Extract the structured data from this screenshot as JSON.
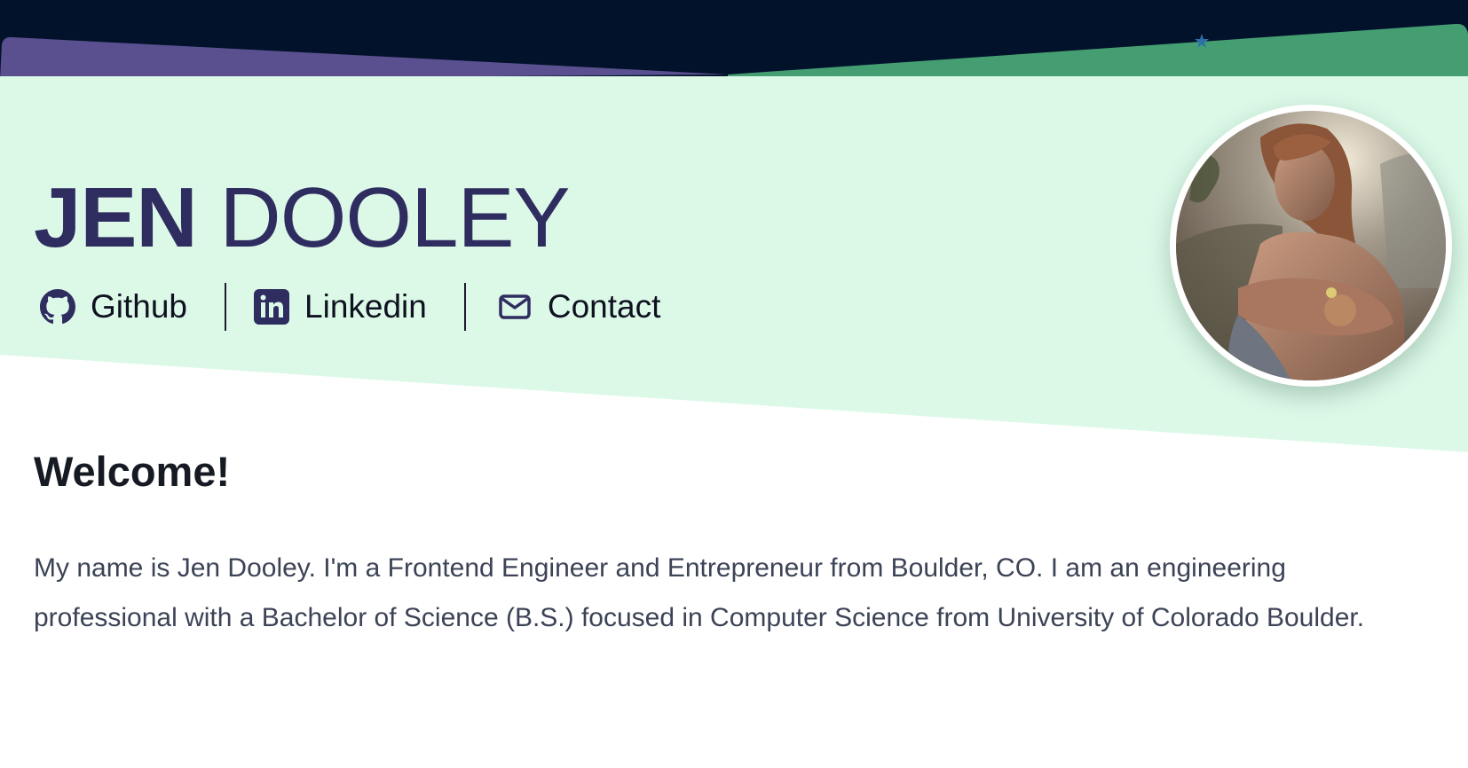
{
  "header": {
    "first_name": "JEN",
    "last_name": "DOOLEY",
    "links": [
      {
        "label": "Github",
        "icon": "github-icon"
      },
      {
        "label": "Linkedin",
        "icon": "linkedin-icon"
      },
      {
        "label": "Contact",
        "icon": "mail-icon"
      }
    ],
    "avatar": "profile-photo"
  },
  "main": {
    "heading": "Welcome!",
    "intro": "My name is Jen Dooley. I'm a Frontend Engineer and Entrepreneur from Boulder, CO. I am an engineering professional with a Bachelor of Science (B.S.) focused in Computer Science from University of Colorado Boulder."
  },
  "colors": {
    "top_band": "#02122a",
    "purple_strip": "#5a5090",
    "green_strip": "#459e72",
    "hero_background": "#dcf9e8",
    "name_color": "#2f2c60",
    "body_text": "#3c4356"
  }
}
